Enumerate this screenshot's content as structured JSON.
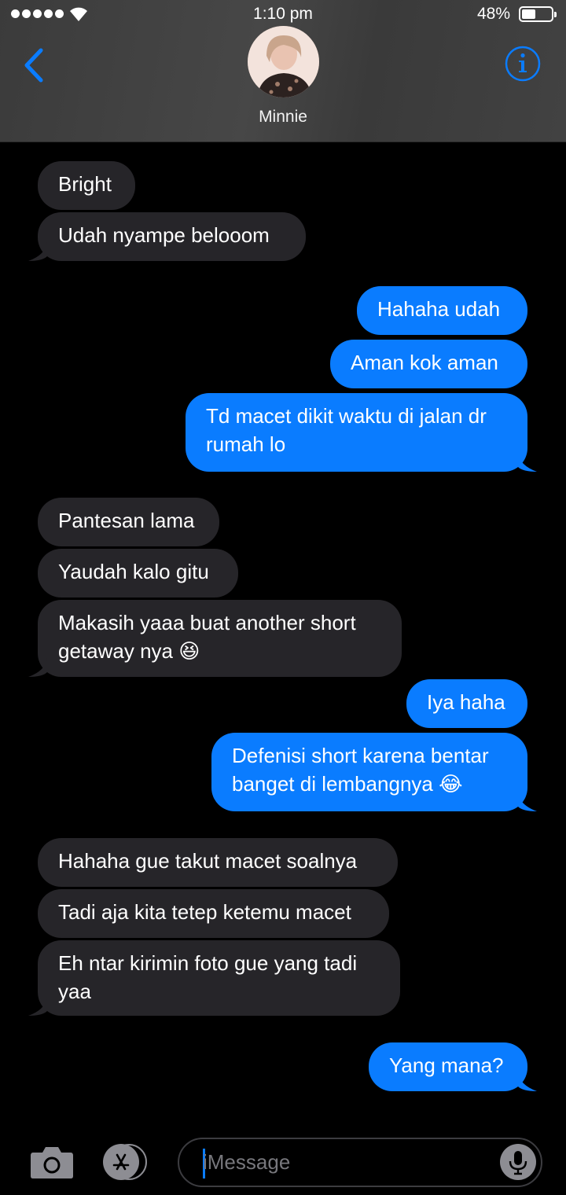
{
  "status_bar": {
    "time": "1:10 pm",
    "battery_percent_label": "48%",
    "battery_level": 0.48
  },
  "header": {
    "contact_name": "Minnie",
    "back_icon": "chevron-left-icon",
    "info_icon": "info-icon"
  },
  "colors": {
    "accent": "#0a7cff",
    "incoming_bubble": "#262529",
    "outgoing_bubble": "#0a7cff",
    "background": "#000000"
  },
  "messages": [
    {
      "dir": "in",
      "text": "Bright"
    },
    {
      "dir": "in",
      "text": "Udah nyampe belooom"
    },
    {
      "dir": "out",
      "text": "Hahaha udah"
    },
    {
      "dir": "out",
      "text": "Aman kok aman"
    },
    {
      "dir": "out",
      "text": "Td macet dikit waktu di jalan dr rumah lo"
    },
    {
      "dir": "in",
      "text": "Pantesan lama"
    },
    {
      "dir": "in",
      "text": "Yaudah kalo gitu"
    },
    {
      "dir": "in",
      "text": "Makasih yaaa buat another short getaway nya 😆"
    },
    {
      "dir": "out",
      "text": "Iya haha"
    },
    {
      "dir": "out",
      "text": "Defenisi short karena bentar banget di lembangnya 😂"
    },
    {
      "dir": "in",
      "text": "Hahaha gue takut macet soalnya"
    },
    {
      "dir": "in",
      "text": "Tadi aja kita tetep ketemu macet"
    },
    {
      "dir": "in",
      "text": "Eh ntar kirimin foto gue yang tadi yaa"
    },
    {
      "dir": "out",
      "text": "Yang mana?"
    },
    {
      "dir": "in",
      "text": ""
    }
  ],
  "input_bar": {
    "placeholder": "iMessage",
    "camera_icon": "camera-icon",
    "apps_icon": "app-store-icon",
    "mic_icon": "microphone-icon"
  }
}
